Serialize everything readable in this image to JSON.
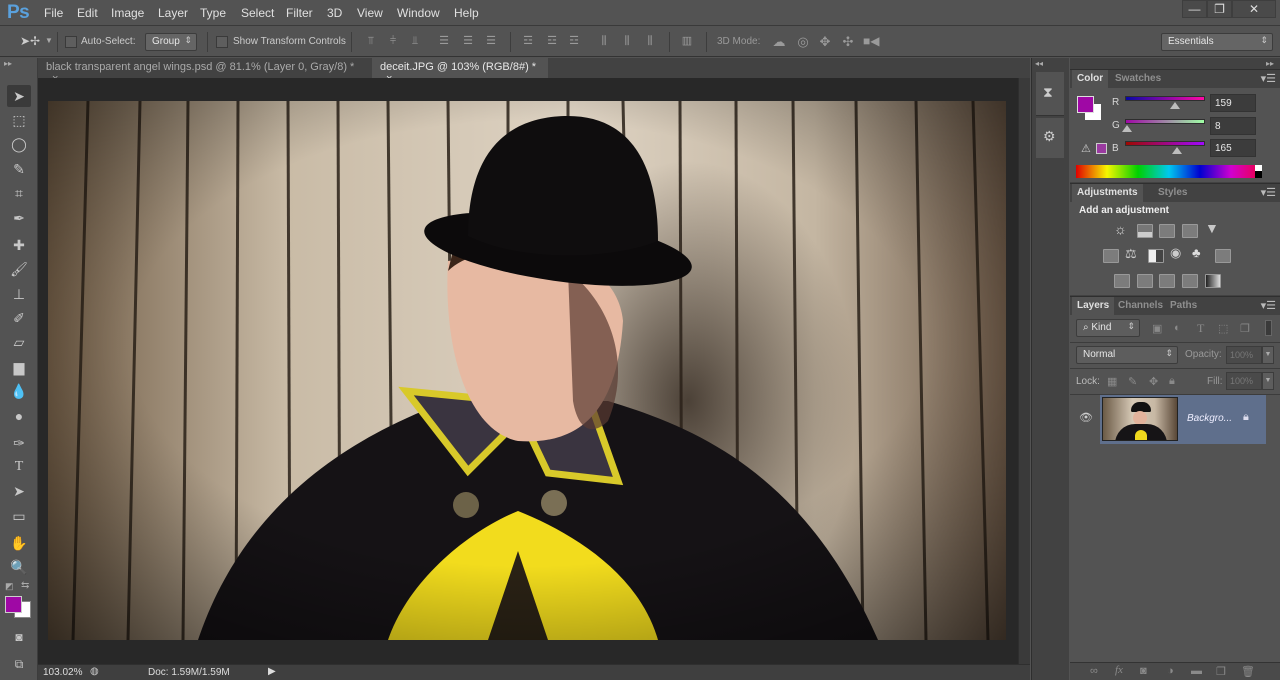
{
  "app": {
    "logo": "Ps",
    "menu": [
      "File",
      "Edit",
      "Image",
      "Layer",
      "Type",
      "Select",
      "Filter",
      "3D",
      "View",
      "Window",
      "Help"
    ],
    "window_controls": {
      "minimize": "—",
      "restore": "❐",
      "close": "✕"
    }
  },
  "options_bar": {
    "tool_icon": "move-tool-icon",
    "auto_select_label": "Auto-Select:",
    "auto_select_checked": false,
    "auto_select_target": "Group",
    "show_transform_label": "Show Transform Controls",
    "show_transform_checked": false,
    "align_icons": [
      "align-top-edges",
      "align-vertical-centers",
      "align-bottom-edges",
      "align-left-edges",
      "align-horizontal-centers",
      "align-right-edges"
    ],
    "distribute_icons": [
      "distribute-top",
      "distribute-vcenter",
      "distribute-bottom",
      "distribute-left",
      "distribute-hcenter",
      "distribute-right"
    ],
    "auto_align_icon": "auto-align-layers",
    "mode_3d_label": "3D Mode:",
    "mode_3d_icons": [
      "rotate-3d",
      "roll-3d",
      "drag-3d",
      "slide-3d",
      "scale-3d"
    ],
    "workspace": "Essentials"
  },
  "documents": {
    "tabs": [
      {
        "label": "black transparent angel wings.psd @ 81.1% (Layer 0, Gray/8) *",
        "close": "×",
        "active": false
      },
      {
        "label": "deceit.JPG @ 103% (RGB/8#) *",
        "close": "×",
        "active": true
      }
    ]
  },
  "status": {
    "zoom": "103.02%",
    "doc_info": "Doc: 1.59M/1.59M",
    "arrow": "▶"
  },
  "tools": [
    "move",
    "marquee",
    "lasso",
    "quick-selection",
    "crop",
    "eyedropper",
    "spot-healing",
    "brush",
    "clone-stamp",
    "history-brush",
    "eraser",
    "gradient",
    "blur",
    "dodge",
    "pen",
    "type",
    "path-selection",
    "rectangle",
    "hand",
    "zoom"
  ],
  "colors": {
    "foreground": "#9f08a5",
    "background": "#ffffff",
    "accent": "#5aa1dd"
  },
  "color_panel": {
    "tabs": [
      "Color",
      "Swatches"
    ],
    "active_tab": "Color",
    "channels": [
      {
        "label": "R",
        "value": "159",
        "fraction": 0.624
      },
      {
        "label": "G",
        "value": "8",
        "fraction": 0.031
      },
      {
        "label": "B",
        "value": "165",
        "fraction": 0.647
      }
    ]
  },
  "adjustments_panel": {
    "tabs": [
      "Adjustments",
      "Styles"
    ],
    "active_tab": "Adjustments",
    "heading": "Add an adjustment",
    "icons_row1": [
      "brightness-contrast",
      "levels",
      "curves",
      "exposure",
      "vibrance"
    ],
    "icons_row2": [
      "hue-saturation",
      "color-balance",
      "black-white",
      "photo-filter",
      "channel-mixer",
      "color-lookup"
    ],
    "icons_row3": [
      "invert",
      "posterize",
      "threshold",
      "selective-color",
      "gradient-map"
    ]
  },
  "layers_panel": {
    "tabs": [
      "Layers",
      "Channels",
      "Paths"
    ],
    "active_tab": "Layers",
    "filter_kind": "Kind",
    "blend_mode": "Normal",
    "opacity_label": "Opacity:",
    "opacity_value": "100%",
    "lock_label": "Lock:",
    "fill_label": "Fill:",
    "fill_value": "100%",
    "layers": [
      {
        "name": "Backgro...",
        "visible": true,
        "locked": true,
        "selected": true
      }
    ],
    "footer_icons": [
      "link-layers",
      "fx",
      "add-mask",
      "new-adjustment",
      "new-group",
      "new-layer",
      "delete-layer"
    ]
  }
}
